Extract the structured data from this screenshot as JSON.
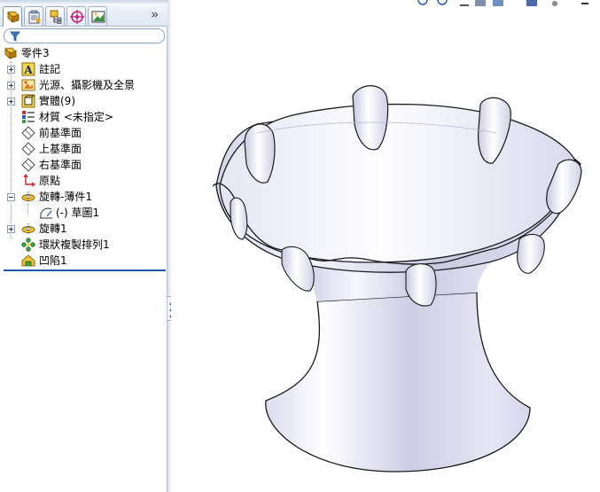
{
  "feature_manager": {
    "tabs": [
      {
        "icon": "feature-tree-icon",
        "active": true
      },
      {
        "icon": "property-manager-icon",
        "active": false
      },
      {
        "icon": "configuration-manager-icon",
        "active": false
      },
      {
        "icon": "dimxpert-icon",
        "active": false
      },
      {
        "icon": "display-manager-icon",
        "active": false
      }
    ],
    "expand_glyph": "»",
    "filter_icon": "filter-icon",
    "tree": [
      {
        "label": "零件3",
        "icon": "part-icon",
        "expander": "none"
      },
      {
        "label": "註記",
        "icon": "annotations-icon",
        "expander": "plus"
      },
      {
        "label": "光源、攝影機及全景",
        "icon": "lights-cameras-scene-icon",
        "expander": "plus"
      },
      {
        "label": "實體(9)",
        "icon": "solid-bodies-icon",
        "expander": "plus"
      },
      {
        "label": "材質 <未指定>",
        "icon": "material-icon",
        "expander": "none"
      },
      {
        "label": "前基準面",
        "icon": "plane-icon",
        "expander": "none"
      },
      {
        "label": "上基準面",
        "icon": "plane-icon",
        "expander": "none"
      },
      {
        "label": "右基準面",
        "icon": "plane-icon",
        "expander": "none"
      },
      {
        "label": "原點",
        "icon": "origin-icon",
        "expander": "none"
      },
      {
        "label": "旋轉-薄件1",
        "icon": "revolve-thin-icon",
        "expander": "minus"
      },
      {
        "label": "(-) 草圖1",
        "icon": "sketch-icon",
        "expander": "none"
      },
      {
        "label": "旋轉1",
        "icon": "revolve-icon",
        "expander": "plus"
      },
      {
        "label": "環狀複製排列1",
        "icon": "circular-pattern-icon",
        "expander": "none"
      },
      {
        "label": "凹陷1",
        "icon": "indent-icon",
        "expander": "none"
      }
    ]
  },
  "viewport": {
    "model": "bowl-on-pedestal-model",
    "toolbar_icons": [
      "zoom-to-fit-icon",
      "zoom-to-area-icon",
      "previous-view-icon",
      "section-view-icon",
      "view-orientation-icon",
      "display-style-icon",
      "hide-show-items-icon",
      "edit-appearance-icon"
    ]
  },
  "colors": {
    "tree_selection_line": "#1f5aa9",
    "panel_border": "#b9c6d6",
    "model_light": "#fbfbff",
    "model_dark": "#c5c5e0",
    "model_edge": "#1a1a1a"
  }
}
